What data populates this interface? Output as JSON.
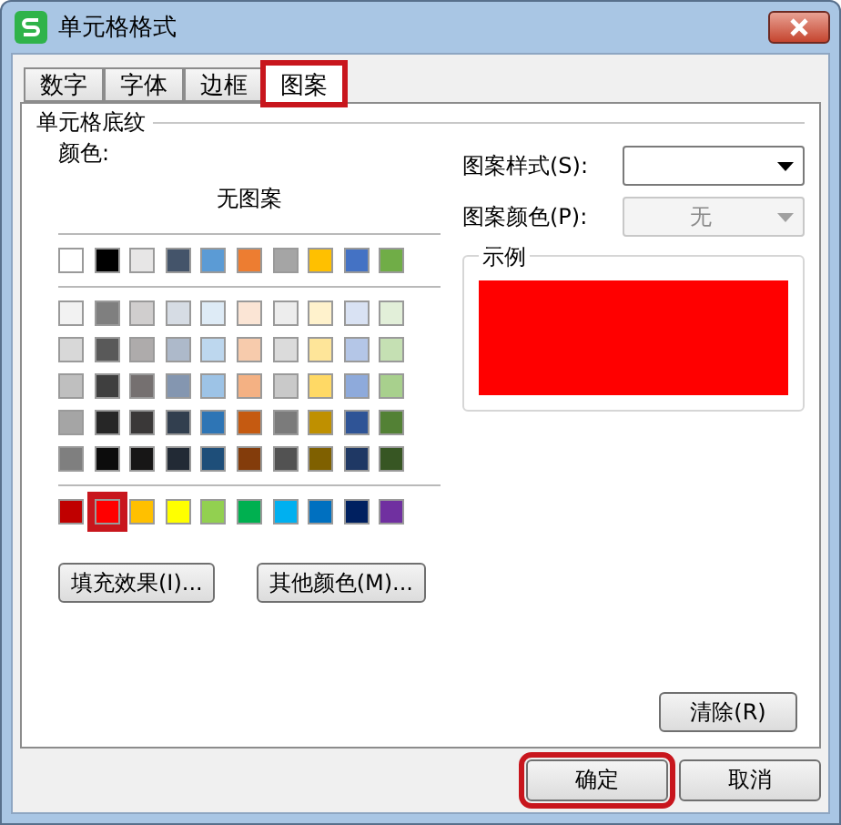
{
  "window": {
    "title": "单元格格式"
  },
  "tabs": [
    {
      "label": "数字",
      "selected": false,
      "annotated": false
    },
    {
      "label": "字体",
      "selected": false,
      "annotated": false
    },
    {
      "label": "边框",
      "selected": false,
      "annotated": false
    },
    {
      "label": "图案",
      "selected": true,
      "annotated": true
    }
  ],
  "shading": {
    "title": "单元格底纹",
    "color_label": "颜色:",
    "no_pattern": "无图案",
    "swatch_groups": [
      {
        "rows": [
          [
            {
              "color": "#ffffff",
              "selected": false
            },
            {
              "color": "#000000",
              "selected": false
            },
            {
              "color": "#e7e6e6",
              "selected": false
            },
            {
              "color": "#44546a",
              "selected": false
            },
            {
              "color": "#5b9bd5",
              "selected": false
            },
            {
              "color": "#ed7d31",
              "selected": false
            },
            {
              "color": "#a5a5a5",
              "selected": false
            },
            {
              "color": "#ffc000",
              "selected": false
            },
            {
              "color": "#4472c4",
              "selected": false
            },
            {
              "color": "#70ad47",
              "selected": false
            }
          ]
        ]
      },
      {
        "rows": [
          [
            {
              "color": "#f2f2f2",
              "selected": false
            },
            {
              "color": "#7f7f7f",
              "selected": false
            },
            {
              "color": "#d0cece",
              "selected": false
            },
            {
              "color": "#d6dce4",
              "selected": false
            },
            {
              "color": "#deebf6",
              "selected": false
            },
            {
              "color": "#fbe5d5",
              "selected": false
            },
            {
              "color": "#ededed",
              "selected": false
            },
            {
              "color": "#fff2cc",
              "selected": false
            },
            {
              "color": "#d9e2f3",
              "selected": false
            },
            {
              "color": "#e2efd9",
              "selected": false
            }
          ],
          [
            {
              "color": "#d8d8d8",
              "selected": false
            },
            {
              "color": "#595959",
              "selected": false
            },
            {
              "color": "#aeabab",
              "selected": false
            },
            {
              "color": "#adb9ca",
              "selected": false
            },
            {
              "color": "#bdd7ee",
              "selected": false
            },
            {
              "color": "#f7cbac",
              "selected": false
            },
            {
              "color": "#dbdbdb",
              "selected": false
            },
            {
              "color": "#fee599",
              "selected": false
            },
            {
              "color": "#b4c6e7",
              "selected": false
            },
            {
              "color": "#c5e0b3",
              "selected": false
            }
          ],
          [
            {
              "color": "#bfbfbf",
              "selected": false
            },
            {
              "color": "#3f3f3f",
              "selected": false
            },
            {
              "color": "#757070",
              "selected": false
            },
            {
              "color": "#8496b0",
              "selected": false
            },
            {
              "color": "#9dc3e6",
              "selected": false
            },
            {
              "color": "#f4b183",
              "selected": false
            },
            {
              "color": "#c9c9c9",
              "selected": false
            },
            {
              "color": "#ffd965",
              "selected": false
            },
            {
              "color": "#8eaadb",
              "selected": false
            },
            {
              "color": "#a8d08d",
              "selected": false
            }
          ],
          [
            {
              "color": "#a5a5a5",
              "selected": false
            },
            {
              "color": "#262626",
              "selected": false
            },
            {
              "color": "#3a3838",
              "selected": false
            },
            {
              "color": "#323f4f",
              "selected": false
            },
            {
              "color": "#2e75b5",
              "selected": false
            },
            {
              "color": "#c55a11",
              "selected": false
            },
            {
              "color": "#7b7b7b",
              "selected": false
            },
            {
              "color": "#bf9000",
              "selected": false
            },
            {
              "color": "#2f5496",
              "selected": false
            },
            {
              "color": "#538135",
              "selected": false
            }
          ],
          [
            {
              "color": "#7f7f7f",
              "selected": false
            },
            {
              "color": "#0c0c0c",
              "selected": false
            },
            {
              "color": "#171616",
              "selected": false
            },
            {
              "color": "#222a35",
              "selected": false
            },
            {
              "color": "#1e4e79",
              "selected": false
            },
            {
              "color": "#833c0b",
              "selected": false
            },
            {
              "color": "#525252",
              "selected": false
            },
            {
              "color": "#7f6000",
              "selected": false
            },
            {
              "color": "#1f3864",
              "selected": false
            },
            {
              "color": "#375623",
              "selected": false
            }
          ]
        ]
      },
      {
        "rows": [
          [
            {
              "color": "#c00000",
              "selected": false
            },
            {
              "color": "#ff0000",
              "selected": true
            },
            {
              "color": "#ffc000",
              "selected": false
            },
            {
              "color": "#ffff00",
              "selected": false
            },
            {
              "color": "#92d050",
              "selected": false
            },
            {
              "color": "#00b050",
              "selected": false
            },
            {
              "color": "#00b0f0",
              "selected": false
            },
            {
              "color": "#0070c0",
              "selected": false
            },
            {
              "color": "#002060",
              "selected": false
            },
            {
              "color": "#7030a0",
              "selected": false
            }
          ]
        ]
      }
    ],
    "buttons": [
      "填充效果(I)...",
      "其他颜色(M)..."
    ],
    "pattern_style": {
      "label": "图案样式(S):"
    },
    "pattern_color": {
      "label": "图案颜色(P):",
      "value": "无",
      "disabled": true
    },
    "sample": {
      "title": "示例",
      "color": "#ff0000"
    },
    "clear_button": "清除(R)"
  },
  "footer": [
    {
      "label": "确定",
      "annotated": true
    },
    {
      "label": "取消",
      "annotated": false
    }
  ]
}
